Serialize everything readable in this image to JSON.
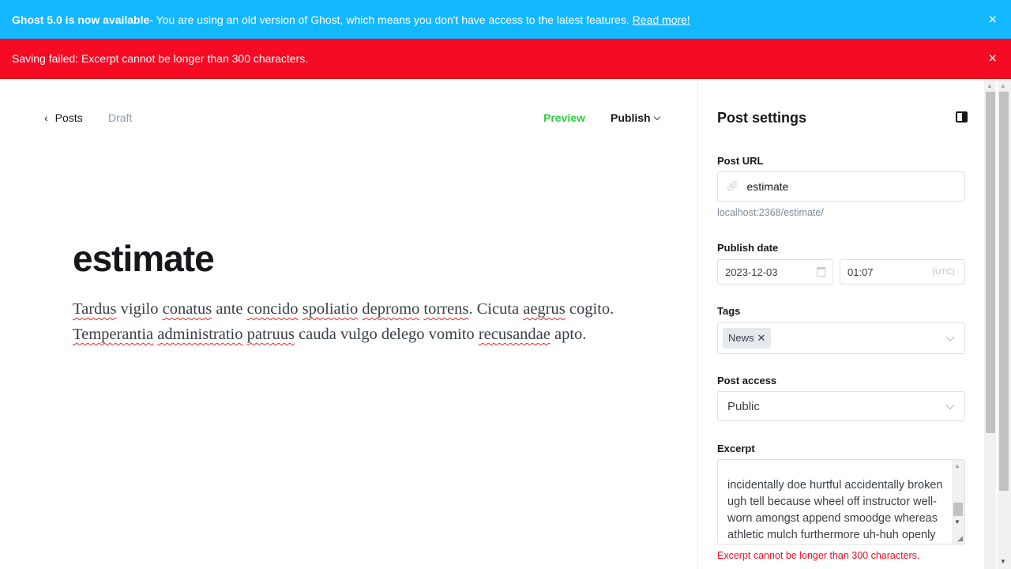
{
  "banners": {
    "update": {
      "bold": "Ghost 5.0 is now available",
      "text": " - You are using an old version of Ghost, which means you don't have access to the latest features.",
      "link": "Read more!"
    },
    "error": {
      "text": "Saving failed: Excerpt cannot be longer than 300 characters."
    },
    "close_icon": "×"
  },
  "editor": {
    "back_label": "Posts",
    "status": "Draft",
    "preview_label": "Preview",
    "publish_label": "Publish",
    "title": "estimate",
    "body_words": [
      {
        "t": "Tardus",
        "s": true
      },
      {
        "t": " vigilo "
      },
      {
        "t": "conatus",
        "s": true
      },
      {
        "t": " ante "
      },
      {
        "t": "concido",
        "s": true
      },
      {
        "t": " "
      },
      {
        "t": "spoliatio",
        "s": true
      },
      {
        "t": " "
      },
      {
        "t": "depromo",
        "s": true
      },
      {
        "t": " "
      },
      {
        "t": "torrens",
        "s": true
      },
      {
        "t": ". Cicuta "
      },
      {
        "t": "aegrus",
        "s": true
      },
      {
        "t": " cogito. "
      },
      {
        "t": "Temperantia",
        "s": true
      },
      {
        "t": " "
      },
      {
        "t": "administratio",
        "s": true
      },
      {
        "t": " "
      },
      {
        "t": "patruus",
        "s": true
      },
      {
        "t": " cauda vulgo delego vomito "
      },
      {
        "t": "recusandae",
        "s": true
      },
      {
        "t": " apto."
      }
    ]
  },
  "settings": {
    "title": "Post settings",
    "post_url_label": "Post URL",
    "post_url_value": "estimate",
    "post_url_hint": "localhost:2368/estimate/",
    "publish_date_label": "Publish date",
    "date_value": "2023-12-03",
    "time_value": "01:07",
    "timezone": "(UTC)",
    "tags_label": "Tags",
    "tags": [
      "News"
    ],
    "access_label": "Post access",
    "access_value": "Public",
    "excerpt_label": "Excerpt",
    "excerpt_value": "incidentally doe hurtful accidentally broken ugh tell because wheel off instructor well-worn amongst append smoodge whereas athletic mulch furthermore uh-huh openly",
    "excerpt_error": "Excerpt cannot be longer than 300 characters."
  },
  "colors": {
    "info": "#14b8ff",
    "error": "#f50b23",
    "preview": "#30cf43"
  }
}
